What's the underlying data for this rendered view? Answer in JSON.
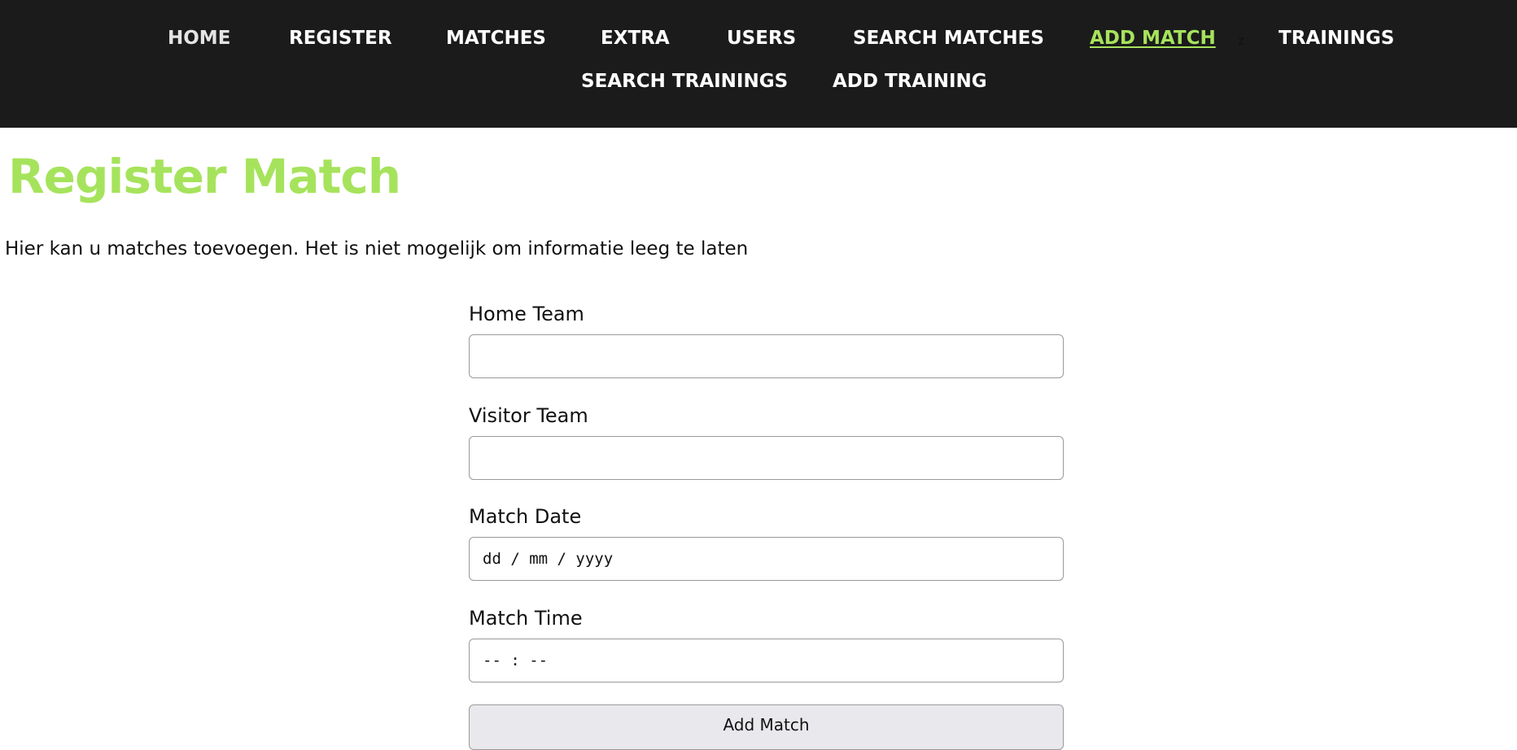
{
  "nav": {
    "home": "HOME",
    "register": "REGISTER",
    "matches": "MATCHES",
    "extra": "EXTRA",
    "users": "USERS",
    "search_matches": "SEARCH MATCHES",
    "add_match": "ADD MATCH",
    "stray_char": "z",
    "trainings": "TRAININGS",
    "search_trainings": "SEARCH TRAININGS",
    "add_training": "ADD TRAINING",
    "active": "ADD MATCH"
  },
  "page": {
    "title": "Register Match",
    "intro": "Hier kan u matches toevoegen. Het is niet mogelijk om informatie leeg te laten"
  },
  "form": {
    "home_team_label": "Home Team",
    "home_team_value": "",
    "visitor_team_label": "Visitor Team",
    "visitor_team_value": "",
    "match_date_label": "Match Date",
    "match_date_placeholder": "dd / mm / yyyy",
    "match_time_label": "Match Time",
    "match_time_placeholder": "-- : --",
    "submit_label": "Add Match"
  },
  "colors": {
    "nav_background": "#1b1b1b",
    "accent_green": "#a6e35c",
    "button_background": "#e9e9ed"
  }
}
